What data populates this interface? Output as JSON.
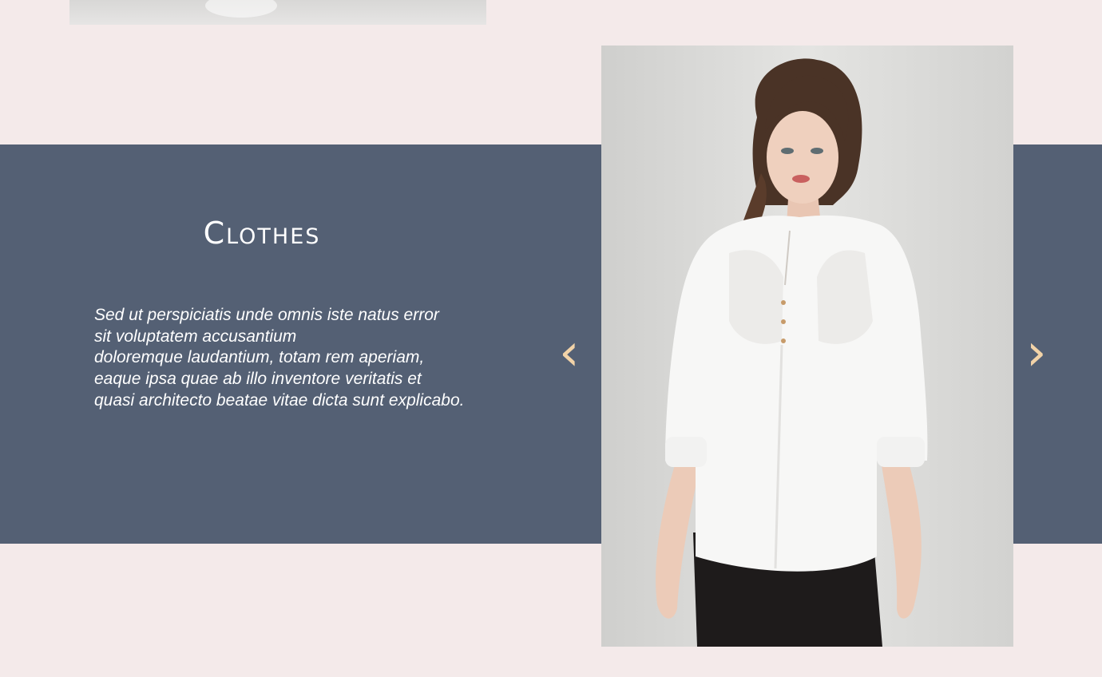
{
  "section": {
    "title": "Clothes",
    "description_lines": [
      "Sed ut perspiciatis unde omnis iste natus error",
      "sit voluptatem accusantium",
      "doloremque laudantium, totam rem aperiam,",
      "eaque ipsa quae ab illo inventore veritatis et",
      "quasi architecto beatae vitae dicta sunt explicabo."
    ]
  },
  "slider": {
    "prev_icon": "‹",
    "next_icon": "›",
    "prev_icon_name": "chevron-left-icon",
    "next_icon_name": "chevron-right-icon"
  },
  "colors": {
    "page_background": "#f4eaea",
    "band": "#546074",
    "arrow": "#f2d3a8",
    "text": "#ffffff"
  }
}
